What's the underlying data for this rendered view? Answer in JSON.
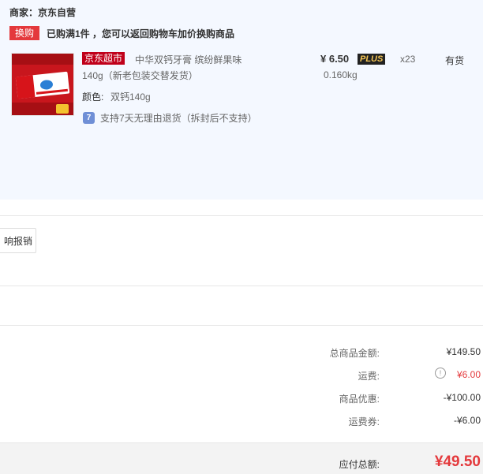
{
  "shop": {
    "merchant_label": "商家：京东自营"
  },
  "promo": {
    "badge": "换购",
    "text": "已购满1件 ，您可以返回购物车加价换购商品"
  },
  "product": {
    "store_tag": "京东超市",
    "name_line1": "中华双钙牙膏 缤纷鲜果味",
    "name_line2": "140g（新老包装交替发货）",
    "price": "¥ 6.50",
    "plus_badge": "PLUS",
    "quantity": "x23",
    "stock": "有货",
    "weight": "0.160kg",
    "color_label": "颜色:",
    "color_value": "双钙140g",
    "return_icon_text": "7",
    "return_policy": "支持7天无理由退货（拆封后不支持）"
  },
  "invoice": {
    "button_label": "响报销"
  },
  "summary": {
    "items": [
      {
        "label": "总商品金额:",
        "value": "¥149.50"
      },
      {
        "label": "运费:",
        "value": "¥6.00"
      },
      {
        "label": "商品优惠:",
        "value": "-¥100.00"
      },
      {
        "label": "运费券:",
        "value": "-¥6.00"
      }
    ],
    "total_label": "应付总额:",
    "total_value": "¥49.50"
  },
  "icons": {
    "return": "return-7days-icon",
    "info": "info-circle-icon"
  },
  "colors": {
    "accent_red": "#e4393c",
    "panel_bg": "#f4f8ff",
    "store_tag_bg": "#c0001a",
    "plus_gold": "#f5c655"
  }
}
